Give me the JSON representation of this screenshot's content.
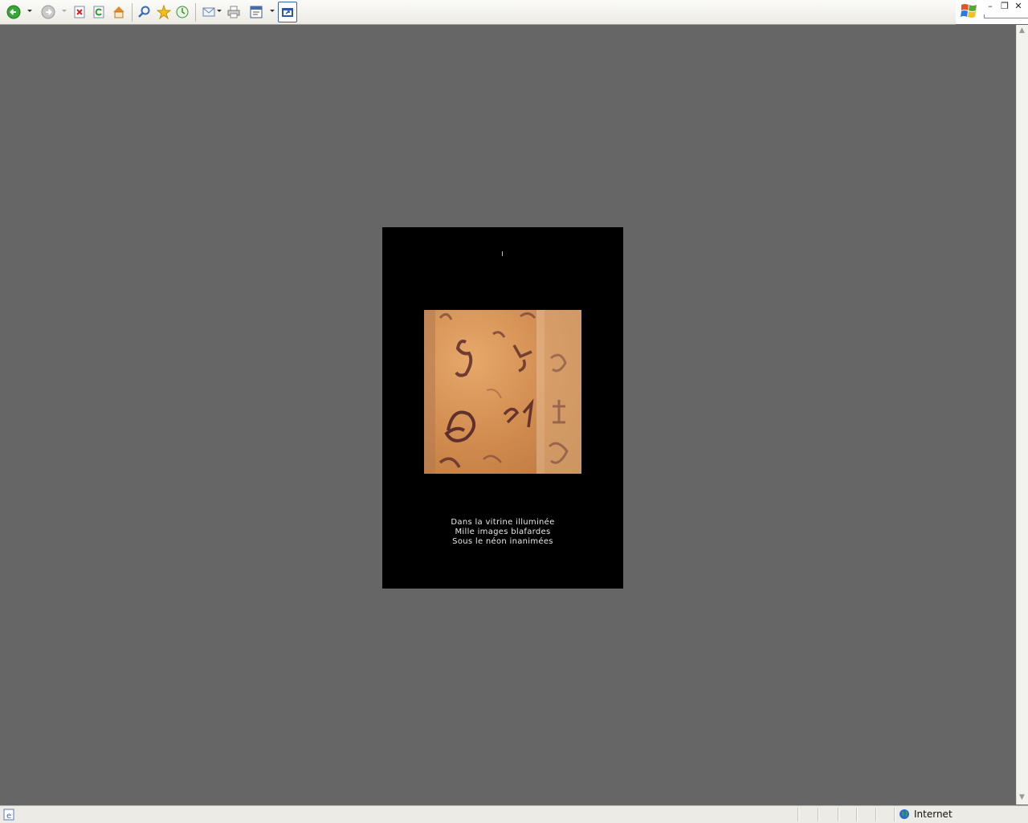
{
  "browser": {
    "toolbar_icons": [
      "back-icon",
      "dropdown-icon",
      "forward-icon",
      "stop-icon",
      "refresh-icon",
      "home-icon",
      "search-icon",
      "favorites-icon",
      "history-icon",
      "mail-icon",
      "print-icon",
      "edit-icon",
      "fullscreen-icon"
    ],
    "window_controls": [
      "minimize-icon",
      "restore-icon",
      "close-icon"
    ],
    "status": {
      "zone": "Internet"
    }
  },
  "poem": {
    "line1": "Dans la vitrine illuminée",
    "line2": "Mille images blafardes",
    "line3": "Sous le néon inanimées"
  },
  "colors": {
    "page_bg": "#666666",
    "card_bg": "#000000",
    "poem_text": "#e8e8e8"
  }
}
